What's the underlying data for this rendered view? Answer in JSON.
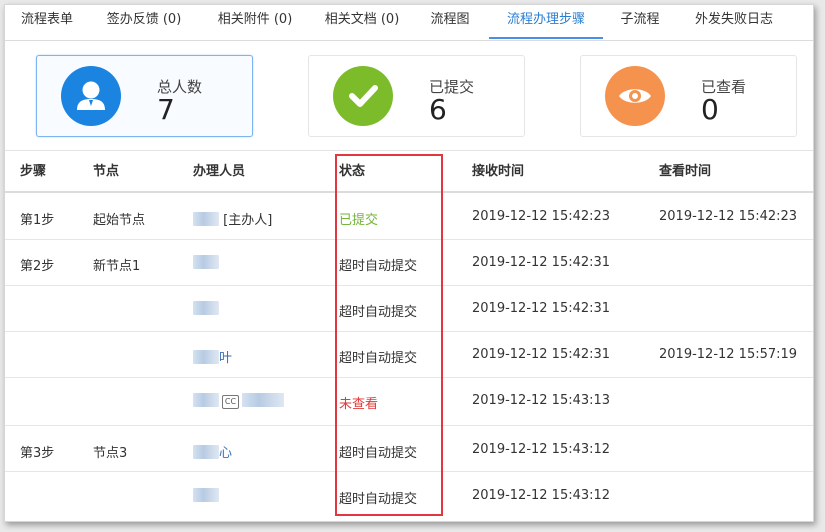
{
  "tabs": [
    {
      "label": "流程表单",
      "active": false
    },
    {
      "label": "签办反馈 (0)",
      "active": false
    },
    {
      "label": "相关附件 (0)",
      "active": false
    },
    {
      "label": "相关文档 (0)",
      "active": false
    },
    {
      "label": "流程图",
      "active": false
    },
    {
      "label": "流程办理步骤",
      "active": true
    },
    {
      "label": "子流程",
      "active": false
    },
    {
      "label": "外发失败日志",
      "active": false
    }
  ],
  "stats": [
    {
      "label": "总人数",
      "value": "7",
      "icon": "user-icon",
      "color": "#1a84e0"
    },
    {
      "label": "已提交",
      "value": "6",
      "icon": "check-icon",
      "color": "#7cbc2a"
    },
    {
      "label": "已查看",
      "value": "0",
      "icon": "eye-icon",
      "color": "#f5924e"
    }
  ],
  "table": {
    "headers": {
      "step": "步骤",
      "node": "节点",
      "handler": "办理人员",
      "status": "状态",
      "received": "接收时间",
      "viewed": "查看时间"
    },
    "rows": [
      {
        "step": "第1步",
        "node": "起始节点",
        "handler": "[主办人]",
        "status": "已提交",
        "received": "2019-12-12 15:42:23",
        "viewed": "2019-12-12 15:42:23"
      },
      {
        "step": "第2步",
        "node": "新节点1",
        "handler": "",
        "status": "超时自动提交",
        "received": "2019-12-12 15:42:31",
        "viewed": ""
      },
      {
        "step": "",
        "node": "",
        "handler": "",
        "status": "超时自动提交",
        "received": "2019-12-12 15:42:31",
        "viewed": ""
      },
      {
        "step": "",
        "node": "",
        "handler": "叶",
        "status": "超时自动提交",
        "received": "2019-12-12 15:42:31",
        "viewed": "2019-12-12 15:57:19"
      },
      {
        "step": "",
        "node": "",
        "handler": "",
        "handler_badge": "CC",
        "status": "未查看",
        "received": "2019-12-12 15:43:13",
        "viewed": ""
      },
      {
        "step": "第3步",
        "node": "节点3",
        "handler": "心",
        "status": "超时自动提交",
        "received": "2019-12-12 15:43:12",
        "viewed": ""
      },
      {
        "step": "",
        "node": "",
        "handler": "",
        "status": "超时自动提交",
        "received": "2019-12-12 15:43:12",
        "viewed": ""
      }
    ]
  }
}
